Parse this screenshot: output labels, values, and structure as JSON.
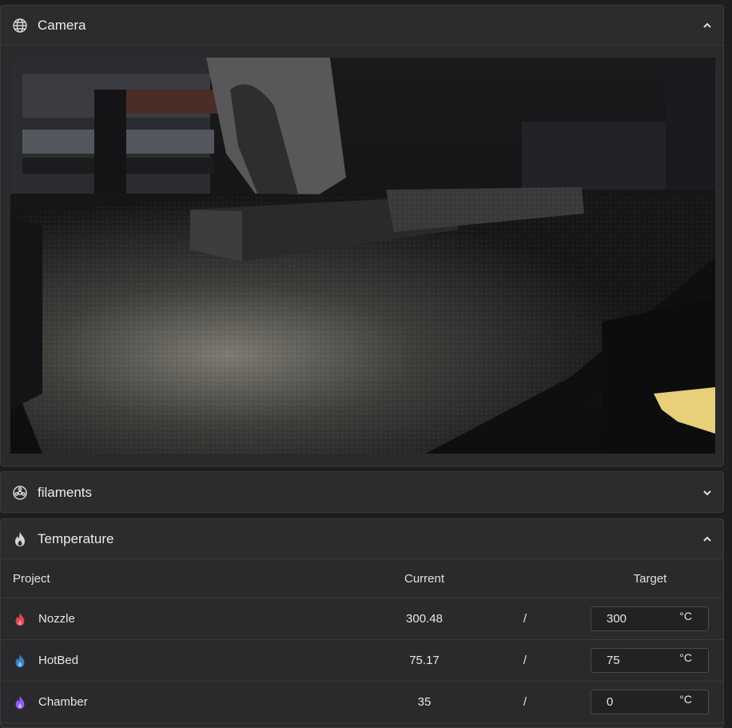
{
  "camera": {
    "title": "Camera",
    "icon": "globe-icon"
  },
  "filaments": {
    "title": "filaments",
    "icon": "spool-icon"
  },
  "temperature": {
    "title": "Temperature",
    "icon": "flame-icon",
    "headers": {
      "project": "Project",
      "current": "Current",
      "target": "Target"
    },
    "rows": [
      {
        "name": "Nozzle",
        "current": "300.48",
        "separator": "/",
        "target": "300",
        "unit": "°C",
        "color": "#e5484d"
      },
      {
        "name": "HotBed",
        "current": "75.17",
        "separator": "/",
        "target": "75",
        "unit": "°C",
        "color": "#3b82c4"
      },
      {
        "name": "Chamber",
        "current": "35",
        "separator": "/",
        "target": "0",
        "unit": "°C",
        "color": "#8b5cf6"
      }
    ]
  },
  "colors": {
    "background": "#1e1e20",
    "panel": "#2a2a2d",
    "border": "#3a3a3e"
  }
}
